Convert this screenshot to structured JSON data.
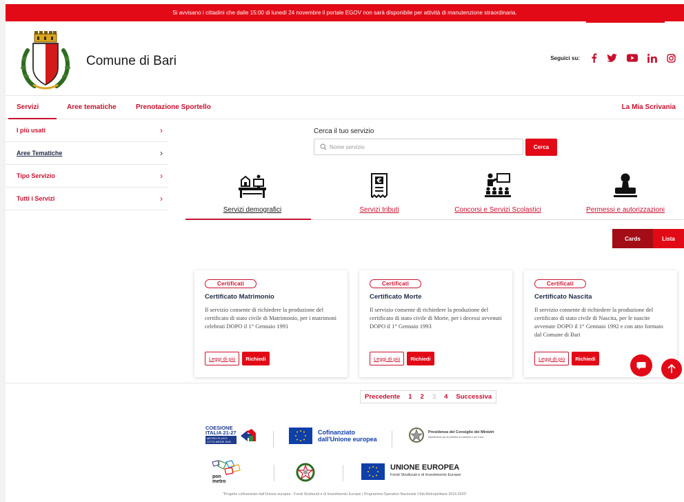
{
  "alert": {
    "text": "Si avvisano i cittadini che dalle 15:00 di lunedì 24 novembre il portale EGOV non sarà disponibile per attività di manutenzione straordinaria."
  },
  "header": {
    "title": "Comune di Bari",
    "social_label": "Seguici su:",
    "social_icons": [
      "facebook-icon",
      "twitter-icon",
      "youtube-icon",
      "linkedin-icon",
      "instagram-icon"
    ]
  },
  "nav": {
    "items": [
      "Servizi",
      "Aree tematiche",
      "Prenotazione Sportello"
    ],
    "right": "La Mia Scrivania"
  },
  "sidebar": {
    "items": [
      "I più usati",
      "Aree Tematiche",
      "Tipo Servizio",
      "Tutti i Servizi"
    ]
  },
  "search": {
    "label": "Cerca il tuo servizio",
    "placeholder": "Nome servizio",
    "button": "Cerca"
  },
  "categories": [
    {
      "label": "Servizi demografici",
      "icon": "office-desk-icon"
    },
    {
      "label": "Servizi tributi",
      "icon": "euro-receipt-icon"
    },
    {
      "label": "Concorsi e Servizi Scolastici",
      "icon": "classroom-icon"
    },
    {
      "label": "Permessi e autorizzazioni",
      "icon": "stamp-icon"
    }
  ],
  "view_toggle": {
    "cards": "Cards",
    "lista": "Lista"
  },
  "cards": [
    {
      "badge": "Certificati",
      "title": "Certificato Matrimonio",
      "description": "Il servizio consente di richiedere la produzione del certificato di stato civile di Matrimonio, per i matrimoni celebrati DOPO il 1° Gennaio 1991",
      "read_more": "Leggi di più",
      "request": "Richiedi"
    },
    {
      "badge": "Certificati",
      "title": "Certificato Morte",
      "description": "Il servizio consente di richiedere la produzione del certificato di stato civile di Morte, per i decessi avvenuti DOPO il 1° Gennaio 1993",
      "read_more": "Leggi di più",
      "request": "Richiedi"
    },
    {
      "badge": "Certificati",
      "title": "Certificato Nascita",
      "description": "Il servizio consente di richiedere la produzione del certificato di stato civile di Nascita, per le nascite avvenute DOPO il 1° Gennaio 1992 e con atto formato dal Comune di Bari",
      "read_more": "Leggi di più",
      "request": "Richiedi"
    }
  ],
  "pagination": {
    "prev": "Precedente",
    "pages": [
      "1",
      "2",
      "3",
      "4"
    ],
    "next": "Successiva"
  },
  "footer": {
    "coesione_line1": "COESIONE",
    "coesione_line2": "ITALIA 21-27",
    "coesione_line3": "METRO PLUS E",
    "coesione_line4": "CITTÀ MEDIE SUD",
    "eu_cofin_line1": "Cofinanziato",
    "eu_cofin_line2": "dall'Unione europea",
    "presidenza_line1": "Presidenza del Consiglio dei Ministri",
    "presidenza_line2": "Dipartimento per le politiche di coesione e per il sud",
    "ponmetro_line1": "pon",
    "ponmetro_line2": "metro",
    "ue_title": "UNIONE EUROPEA",
    "ue_subtitle": "Fondi Strutturali e di Investimento Europei",
    "note": "\"Progetto cofinanziato dall'Unione europea - Fondi Strutturali e di Investimento Europei | Programma Operativo Nazionale Città Metropolitane 2014-2020\""
  }
}
